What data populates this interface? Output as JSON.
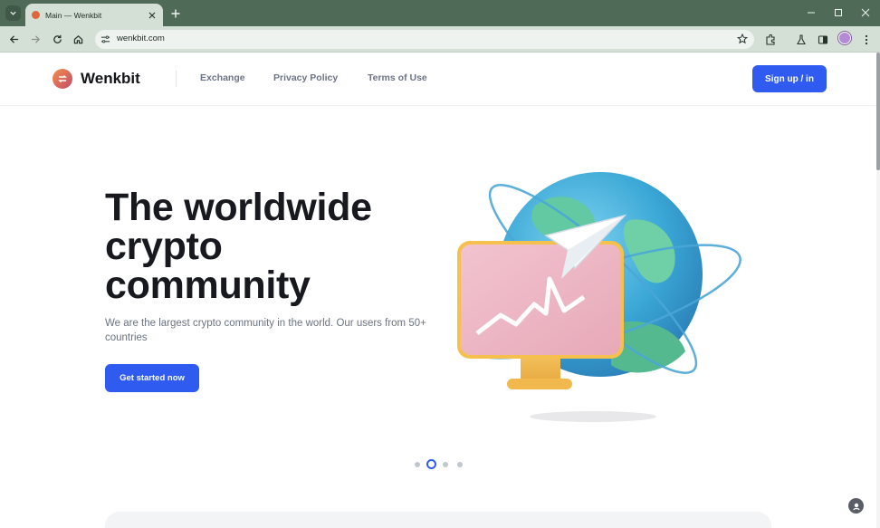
{
  "browser": {
    "tab_title": "Main — Wenkbit",
    "url": "wenkbit.com"
  },
  "site": {
    "brand": "Wenkbit",
    "nav": [
      "Exchange",
      "Privacy Policy",
      "Terms of Use"
    ],
    "signup_label": "Sign up / in"
  },
  "hero": {
    "title_line1": "The worldwide",
    "title_line2": "crypto",
    "title_line3": "community",
    "subtitle": "We are the largest crypto community in the world. Our users from 50+ countries",
    "cta_label": "Get started now"
  },
  "carousel": {
    "slide_count": 4,
    "active_index": 1
  },
  "colors": {
    "accent": "#2f5bf0",
    "chrome": "#4f6b58"
  },
  "icons": [
    "tab-search-icon",
    "favicon-icon",
    "close-icon",
    "plus-icon",
    "minimize-icon",
    "maximize-icon",
    "window-close-icon",
    "back-icon",
    "forward-icon",
    "reload-icon",
    "home-icon",
    "site-info-icon",
    "star-icon",
    "extensions-icon",
    "labs-icon",
    "sidebar-icon",
    "menu-icon",
    "assistant-icon"
  ]
}
